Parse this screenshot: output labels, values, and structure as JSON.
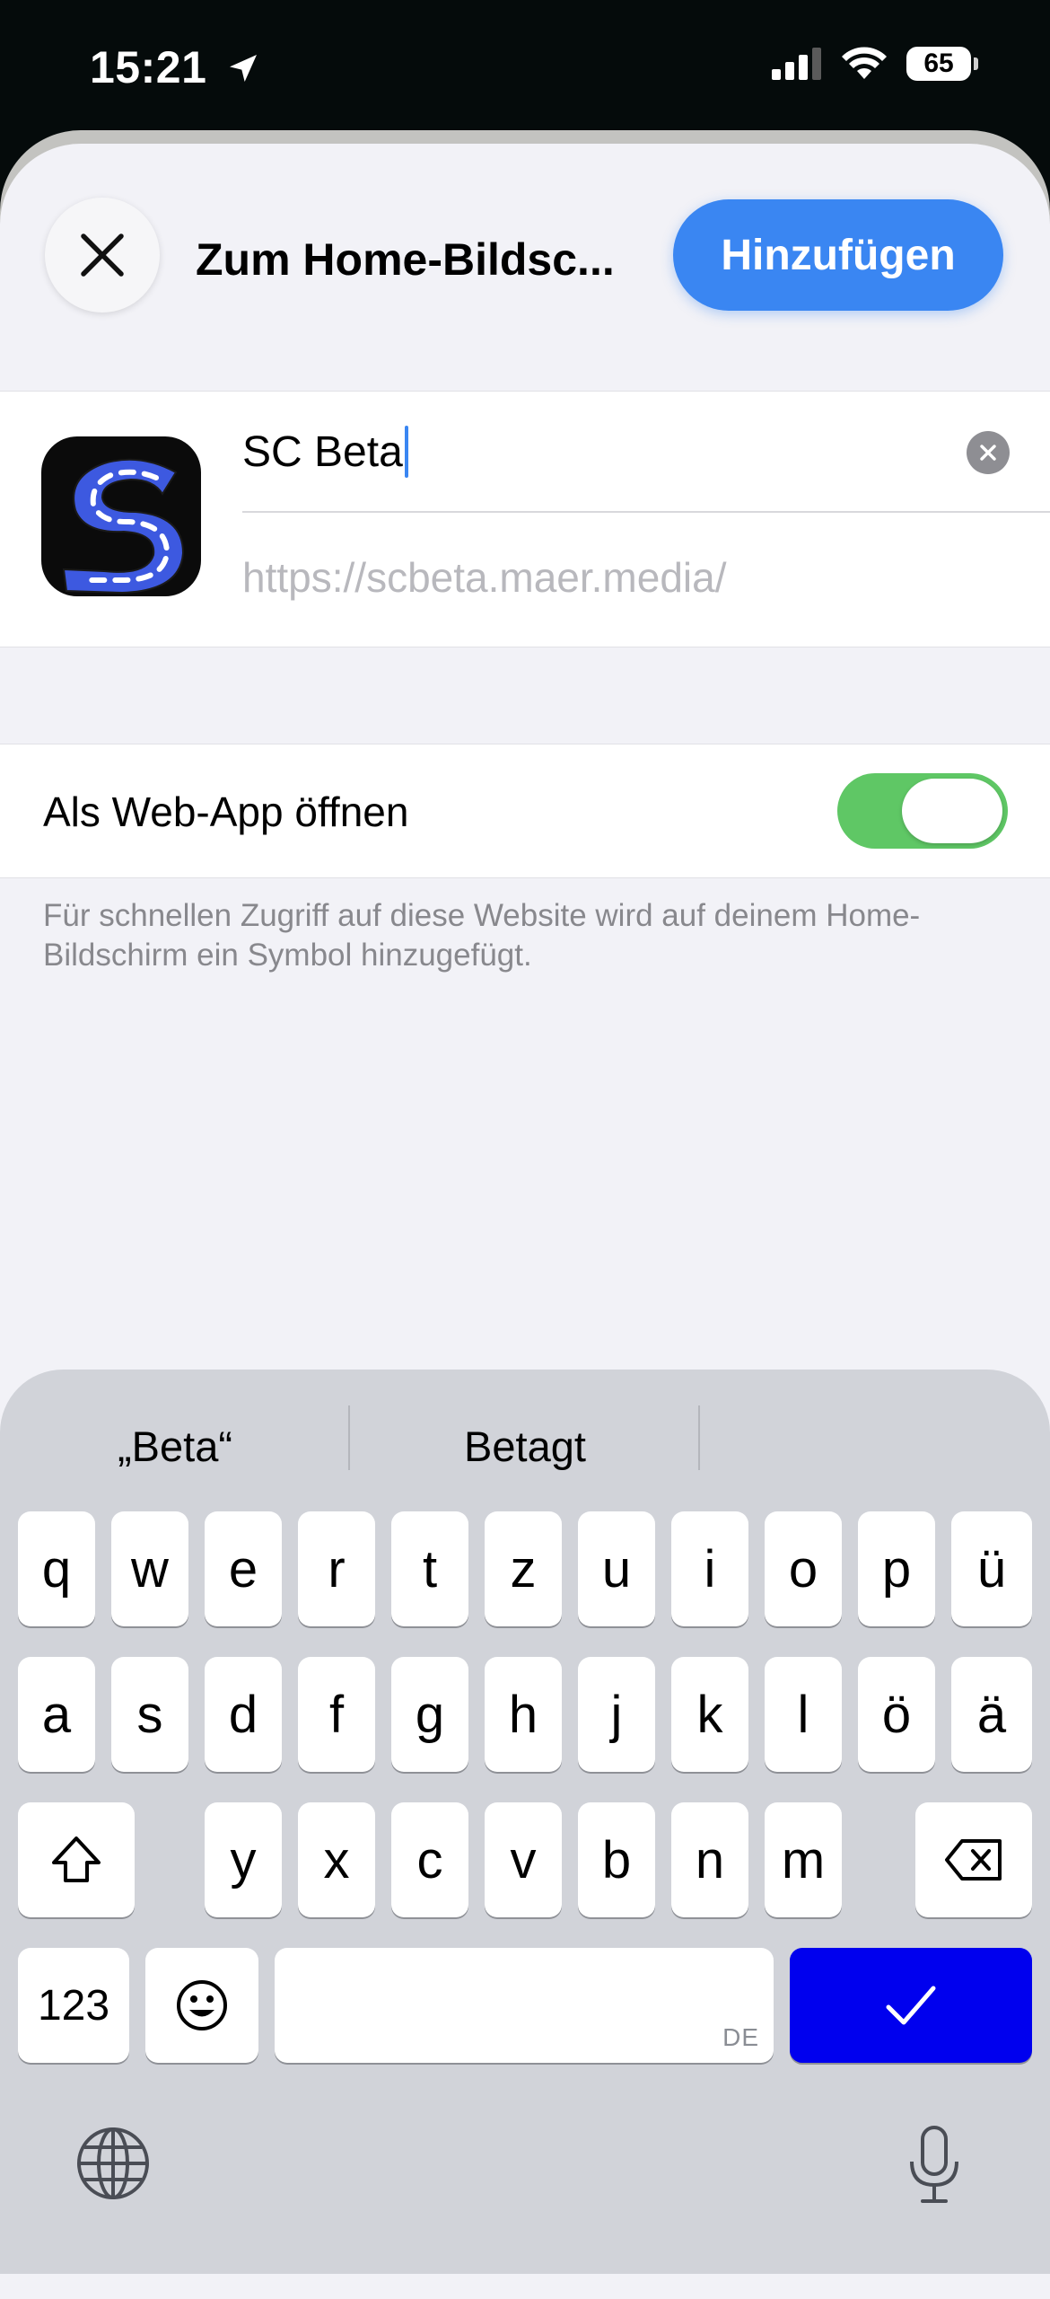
{
  "status_bar": {
    "time": "15:21",
    "battery": "65"
  },
  "sheet": {
    "title": "Zum Home-Bildsc...",
    "add_button": "Hinzufügen",
    "name_field": {
      "value": "SC Beta"
    },
    "url": "https://scbeta.maer.media/",
    "web_app_toggle": {
      "label": "Als Web-App öffnen",
      "on": true
    },
    "note": "Für schnellen Zugriff auf diese Website wird auf deinem Home-Bildschirm ein Symbol hinzugefügt."
  },
  "keyboard": {
    "suggestions": [
      "„Beta“",
      "Betagt",
      ""
    ],
    "row1": [
      "q",
      "w",
      "e",
      "r",
      "t",
      "z",
      "u",
      "i",
      "o",
      "p",
      "ü"
    ],
    "row2": [
      "a",
      "s",
      "d",
      "f",
      "g",
      "h",
      "j",
      "k",
      "l",
      "ö",
      "ä"
    ],
    "row3": [
      "y",
      "x",
      "c",
      "v",
      "b",
      "n",
      "m"
    ],
    "numbers_key": "123",
    "space_language": "DE"
  },
  "colors": {
    "accent": "#3a86f2",
    "toggle_on": "#5fc765",
    "done_key": "#0000ee"
  }
}
